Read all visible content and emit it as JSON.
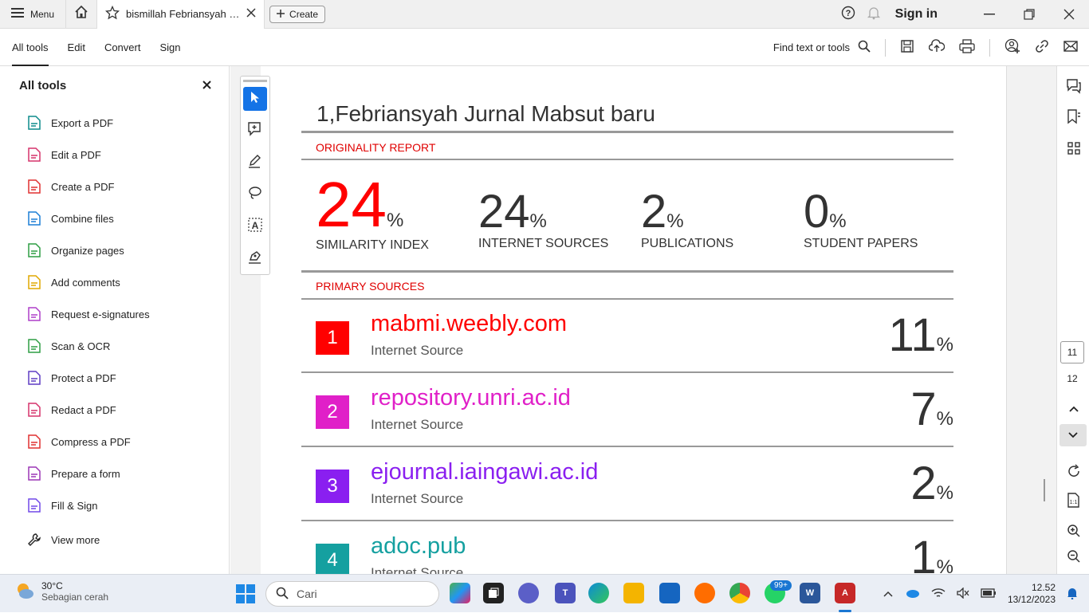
{
  "tabbar": {
    "menu_label": "Menu",
    "tab_title": "bismillah Febriansyah Ju...",
    "create_label": "Create",
    "sign_in": "Sign in"
  },
  "toolbar": {
    "tabs": [
      "All tools",
      "Edit",
      "Convert",
      "Sign"
    ],
    "find_label": "Find text or tools"
  },
  "sidebar": {
    "title": "All tools",
    "items": [
      {
        "label": "Export a PDF",
        "color": "#0d8b8b"
      },
      {
        "label": "Edit a PDF",
        "color": "#d6336c"
      },
      {
        "label": "Create a PDF",
        "color": "#e03131"
      },
      {
        "label": "Combine files",
        "color": "#1c7ed6"
      },
      {
        "label": "Organize pages",
        "color": "#2f9e44"
      },
      {
        "label": "Add comments",
        "color": "#e0a800"
      },
      {
        "label": "Request e-signatures",
        "color": "#ae3ec9"
      },
      {
        "label": "Scan & OCR",
        "color": "#2f9e44"
      },
      {
        "label": "Protect a PDF",
        "color": "#5f3dc4"
      },
      {
        "label": "Redact a PDF",
        "color": "#d6336c"
      },
      {
        "label": "Compress a PDF",
        "color": "#e03131"
      },
      {
        "label": "Prepare a form",
        "color": "#9c36b5"
      },
      {
        "label": "Fill & Sign",
        "color": "#7048e8"
      }
    ],
    "view_more": "View more"
  },
  "document": {
    "title": "1,Febriansyah Jurnal Mabsut baru",
    "originality_label": "ORIGINALITY REPORT",
    "stats": [
      {
        "value": "24",
        "pct": "%",
        "label": "SIMILARITY INDEX",
        "color": "#ff0000"
      },
      {
        "value": "24",
        "pct": "%",
        "label": "INTERNET SOURCES",
        "color": "#333333"
      },
      {
        "value": "2",
        "pct": "%",
        "label": "PUBLICATIONS",
        "color": "#333333"
      },
      {
        "value": "0",
        "pct": "%",
        "label": "STUDENT PAPERS",
        "color": "#333333"
      }
    ],
    "primary_label": "PRIMARY SOURCES",
    "sources": [
      {
        "rank": "1",
        "name": "mabmi.weebly.com",
        "kind": "Internet Source",
        "pct": "11",
        "color": "#ff0000"
      },
      {
        "rank": "2",
        "name": "repository.unri.ac.id",
        "kind": "Internet Source",
        "pct": "7",
        "color": "#e020c8"
      },
      {
        "rank": "3",
        "name": "ejournal.iaingawi.ac.id",
        "kind": "Internet Source",
        "pct": "2",
        "color": "#8a1ff0"
      },
      {
        "rank": "4",
        "name": "adoc.pub",
        "kind": "Internet Source",
        "pct": "1",
        "color": "#15a0a0"
      }
    ],
    "pct_symbol": "%"
  },
  "page_nav": {
    "current": "11",
    "next": "12"
  },
  "taskbar": {
    "temp": "30°C",
    "weather": "Sebagian cerah",
    "search_placeholder": "Cari",
    "badge": "99+",
    "time": "12.52",
    "date": "13/12/2023"
  }
}
